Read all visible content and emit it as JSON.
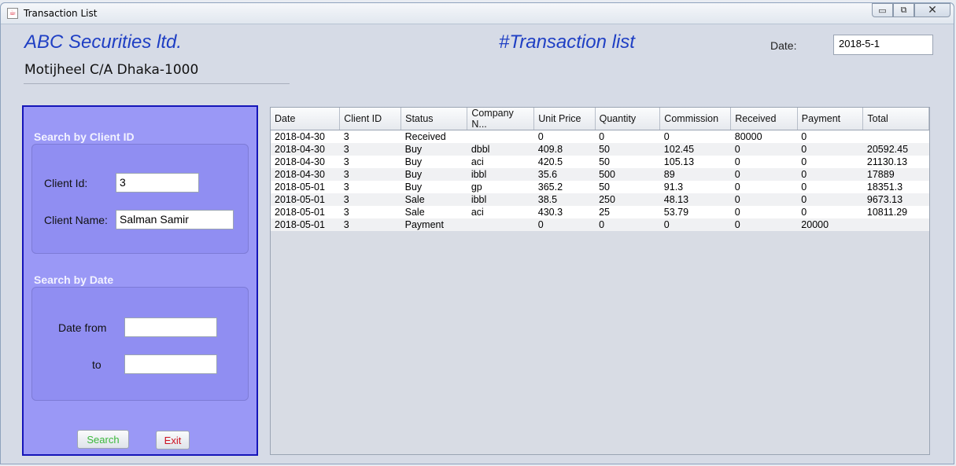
{
  "window": {
    "title": "Transaction List",
    "minimize_glyph": "▭",
    "restore_glyph": "⧉",
    "close_glyph": "✕"
  },
  "header": {
    "company": "ABC Securities ltd.",
    "address": "Motijheel C/A Dhaka-1000",
    "page_title": "#Transaction list",
    "date_label": "Date:",
    "date_value": "2018-5-1"
  },
  "search_client": {
    "title": "Search by Client ID",
    "client_id_label": "Client Id:",
    "client_id_value": "3",
    "client_name_label": "Client Name:",
    "client_name_value": "Salman Samir"
  },
  "search_date": {
    "title": "Search by Date",
    "from_label": "Date from",
    "from_value": "",
    "to_label": "to",
    "to_value": ""
  },
  "buttons": {
    "search": "Search",
    "exit": "Exit"
  },
  "colors": {
    "search_text": "#3ab83a",
    "exit_text": "#cc1020",
    "panel": "#9a98f6",
    "accent": "#1f3fc4"
  },
  "table": {
    "columns": [
      "Date",
      "Client ID",
      "Status",
      "Company N...",
      "Unit Price",
      "Quantity",
      "Commission",
      "Received",
      "Payment",
      "Total"
    ],
    "rows": [
      [
        "2018-04-30",
        "3",
        "Received",
        "",
        "0",
        "0",
        "0",
        "80000",
        "0",
        ""
      ],
      [
        "2018-04-30",
        "3",
        "Buy",
        "dbbl",
        "409.8",
        "50",
        "102.45",
        "0",
        "0",
        "20592.45"
      ],
      [
        "2018-04-30",
        "3",
        "Buy",
        "aci",
        "420.5",
        "50",
        "105.13",
        "0",
        "0",
        "21130.13"
      ],
      [
        "2018-04-30",
        "3",
        "Buy",
        "ibbl",
        "35.6",
        "500",
        "89",
        "0",
        "0",
        "17889"
      ],
      [
        "2018-05-01",
        "3",
        "Buy",
        "gp",
        "365.2",
        "50",
        "91.3",
        "0",
        "0",
        "18351.3"
      ],
      [
        "2018-05-01",
        "3",
        "Sale",
        "ibbl",
        "38.5",
        "250",
        "48.13",
        "0",
        "0",
        "9673.13"
      ],
      [
        "2018-05-01",
        "3",
        "Sale",
        "aci",
        "430.3",
        "25",
        "53.79",
        "0",
        "0",
        "10811.29"
      ],
      [
        "2018-05-01",
        "3",
        "Payment",
        "",
        "0",
        "0",
        "0",
        "0",
        "20000",
        ""
      ]
    ]
  }
}
